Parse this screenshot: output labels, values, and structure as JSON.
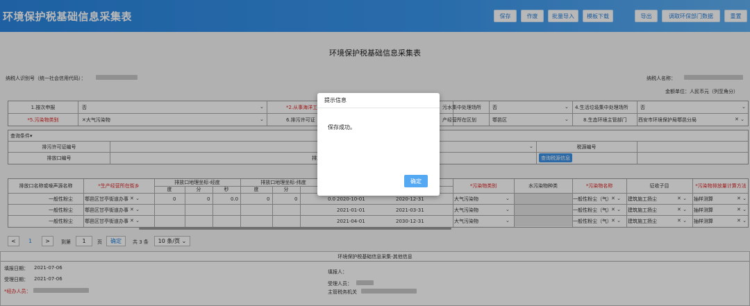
{
  "app": {
    "title": "环境保护税基础信息采集表",
    "toolbar": [
      "保存",
      "作废",
      "批量导入",
      "模板下载",
      "导出",
      "调取环保部门数据",
      "重置"
    ]
  },
  "form": {
    "title": "环境保护税基础信息采集表",
    "taxpayer_id_label": "纳税人识别号（统一社会信用代码）：",
    "taxpayer_name_label": "纳税人名称：",
    "currency_note": "金额单位：人民币元（列至角分）",
    "row1": {
      "q1_label": "1.按次申报",
      "q1_value": "否",
      "q2_label": "*2.从事海洋工",
      "q3_label": "污水集中处理场所",
      "q3_value": "否",
      "q4_label": "4.生活垃圾集中处理场所",
      "q4_value": "否"
    },
    "row2": {
      "q5_label": "*5.污染物类别",
      "q5_value": "大气污染物",
      "q6_label": "6.排污许可证",
      "q7_label": "产经营所在区划",
      "q7_value": "鄠邑区",
      "q8_label": "8.生态环境主管部门",
      "q8_value": "西安市环境保护局鄠邑分局"
    }
  },
  "query": {
    "section_label": "查询条件▾",
    "permit_label": "排污许可证编号",
    "outlet_label": "排放口编号",
    "tax_source_label": "税源编号",
    "query_button": "查询税源信息",
    "mid_label_1": "污",
    "mid_label_2": "排放口"
  },
  "table": {
    "headers": {
      "outlet_name": "排放口名称或噪声源名称",
      "street": "*生产经营所在街乡",
      "lng_group": "排放口地理坐标-经度",
      "lat_group": "排放口地理坐标-纬度",
      "deg": "度",
      "min": "分",
      "sec": "秒",
      "pollutant_type": "*污染物类别",
      "water_type": "水污染物种类",
      "pollutant_name": "*污染物名称",
      "tax_item": "征收子目",
      "calc_method": "*污染物排放量计算方法"
    },
    "rows": [
      {
        "name": "一般性粉尘",
        "street": "鄠邑区甘亭街道办事",
        "lng_d": "0",
        "lng_m": "0",
        "lng_s": "0.0",
        "lat_d": "0",
        "lat_m": "0",
        "lat_s": "0.0",
        "start": "2020-10-01",
        "end": "2020-12-31",
        "ptype": "大气污染物",
        "pname": "一般性粉尘（气）",
        "item": "建筑施工扬尘",
        "method": "抽样测算"
      },
      {
        "name": "一般性粉尘",
        "street": "鄠邑区甘亭街道办事",
        "lng_d": "",
        "lng_m": "",
        "lng_s": "",
        "lat_d": "",
        "lat_m": "",
        "lat_s": "",
        "start": "2021-01-01",
        "end": "2021-03-31",
        "ptype": "大气污染物",
        "pname": "一般性粉尘（气）",
        "item": "建筑施工扬尘",
        "method": "抽样测算"
      },
      {
        "name": "一般性粉尘",
        "street": "鄠邑区甘亭街道办事",
        "lng_d": "",
        "lng_m": "",
        "lng_s": "",
        "lat_d": "",
        "lat_m": "",
        "lat_s": "",
        "start": "2021-04-01",
        "end": "2030-12-31",
        "ptype": "大气污染物",
        "pname": "一般性粉尘（气）",
        "item": "建筑施工扬尘",
        "method": "抽样测算"
      }
    ]
  },
  "pager": {
    "prev": "<",
    "page": "1",
    "next": ">",
    "goto_label": "到第",
    "goto_value": "1",
    "page_unit": "页",
    "confirm": "确定",
    "total": "共 3 条",
    "page_size": "10 条/页"
  },
  "other": {
    "title": "环境保护税基础信息采集-其他信息",
    "fill_date_label": "填报日期：",
    "fill_date": "2021-07-06",
    "accept_date_label": "受理日期：",
    "accept_date": "2021-07-06",
    "agent_label": "*经办人员：",
    "filler_label": "填报人：",
    "acceptor_label": "受理人员：",
    "tax_office_label": "主管税务机关"
  },
  "dialog": {
    "title": "提示信息",
    "message": "保存成功。",
    "ok": "确定"
  },
  "colors": {
    "accent": "#2a86e0",
    "button": "#55a8f2",
    "required": "#dd2222"
  }
}
